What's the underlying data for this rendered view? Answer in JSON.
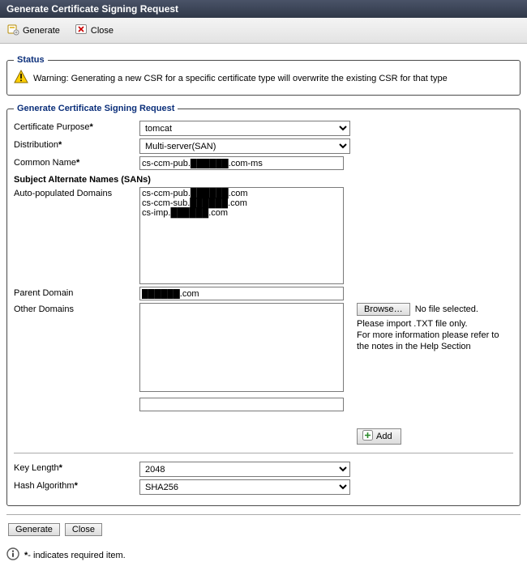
{
  "window": {
    "title": "Generate Certificate Signing Request"
  },
  "toolbar": {
    "generate": "Generate",
    "close": "Close"
  },
  "status": {
    "legend": "Status",
    "text": "Warning: Generating a new CSR for a specific certificate type will overwrite the existing CSR for that type"
  },
  "form": {
    "legend": "Generate Certificate Signing Request",
    "labels": {
      "purpose": "Certificate Purpose",
      "distribution": "Distribution",
      "commonName": "Common Name",
      "san_header": "Subject Alternate Names (SANs)",
      "autoDomains": "Auto-populated Domains",
      "parentDomain": "Parent Domain",
      "otherDomains": "Other Domains",
      "keyLength": "Key Length",
      "hashAlgorithm": "Hash Algorithm"
    },
    "values": {
      "purpose": "tomcat",
      "distribution": "Multi-server(SAN)",
      "commonName": "cs-ccm-pub.██████.com-ms",
      "autoDomains": "cs-ccm-pub.██████.com\ncs-ccm-sub.██████.com\ncs-imp.██████.com",
      "parentDomain": "██████.com",
      "otherDomains": "",
      "otherDomainsInput": "",
      "keyLength": "2048",
      "hashAlgorithm": "SHA256"
    },
    "buttons": {
      "browse": "Browse…",
      "browseStatus": "No file selected.",
      "importHint1": "Please import .TXT file only.",
      "importHint2": "For more information please refer to the notes in the Help Section",
      "add": "Add"
    }
  },
  "bottom": {
    "generate": "Generate",
    "close": "Close"
  },
  "footer": {
    "note": "- indicates required item.",
    "asterisk": "*"
  }
}
